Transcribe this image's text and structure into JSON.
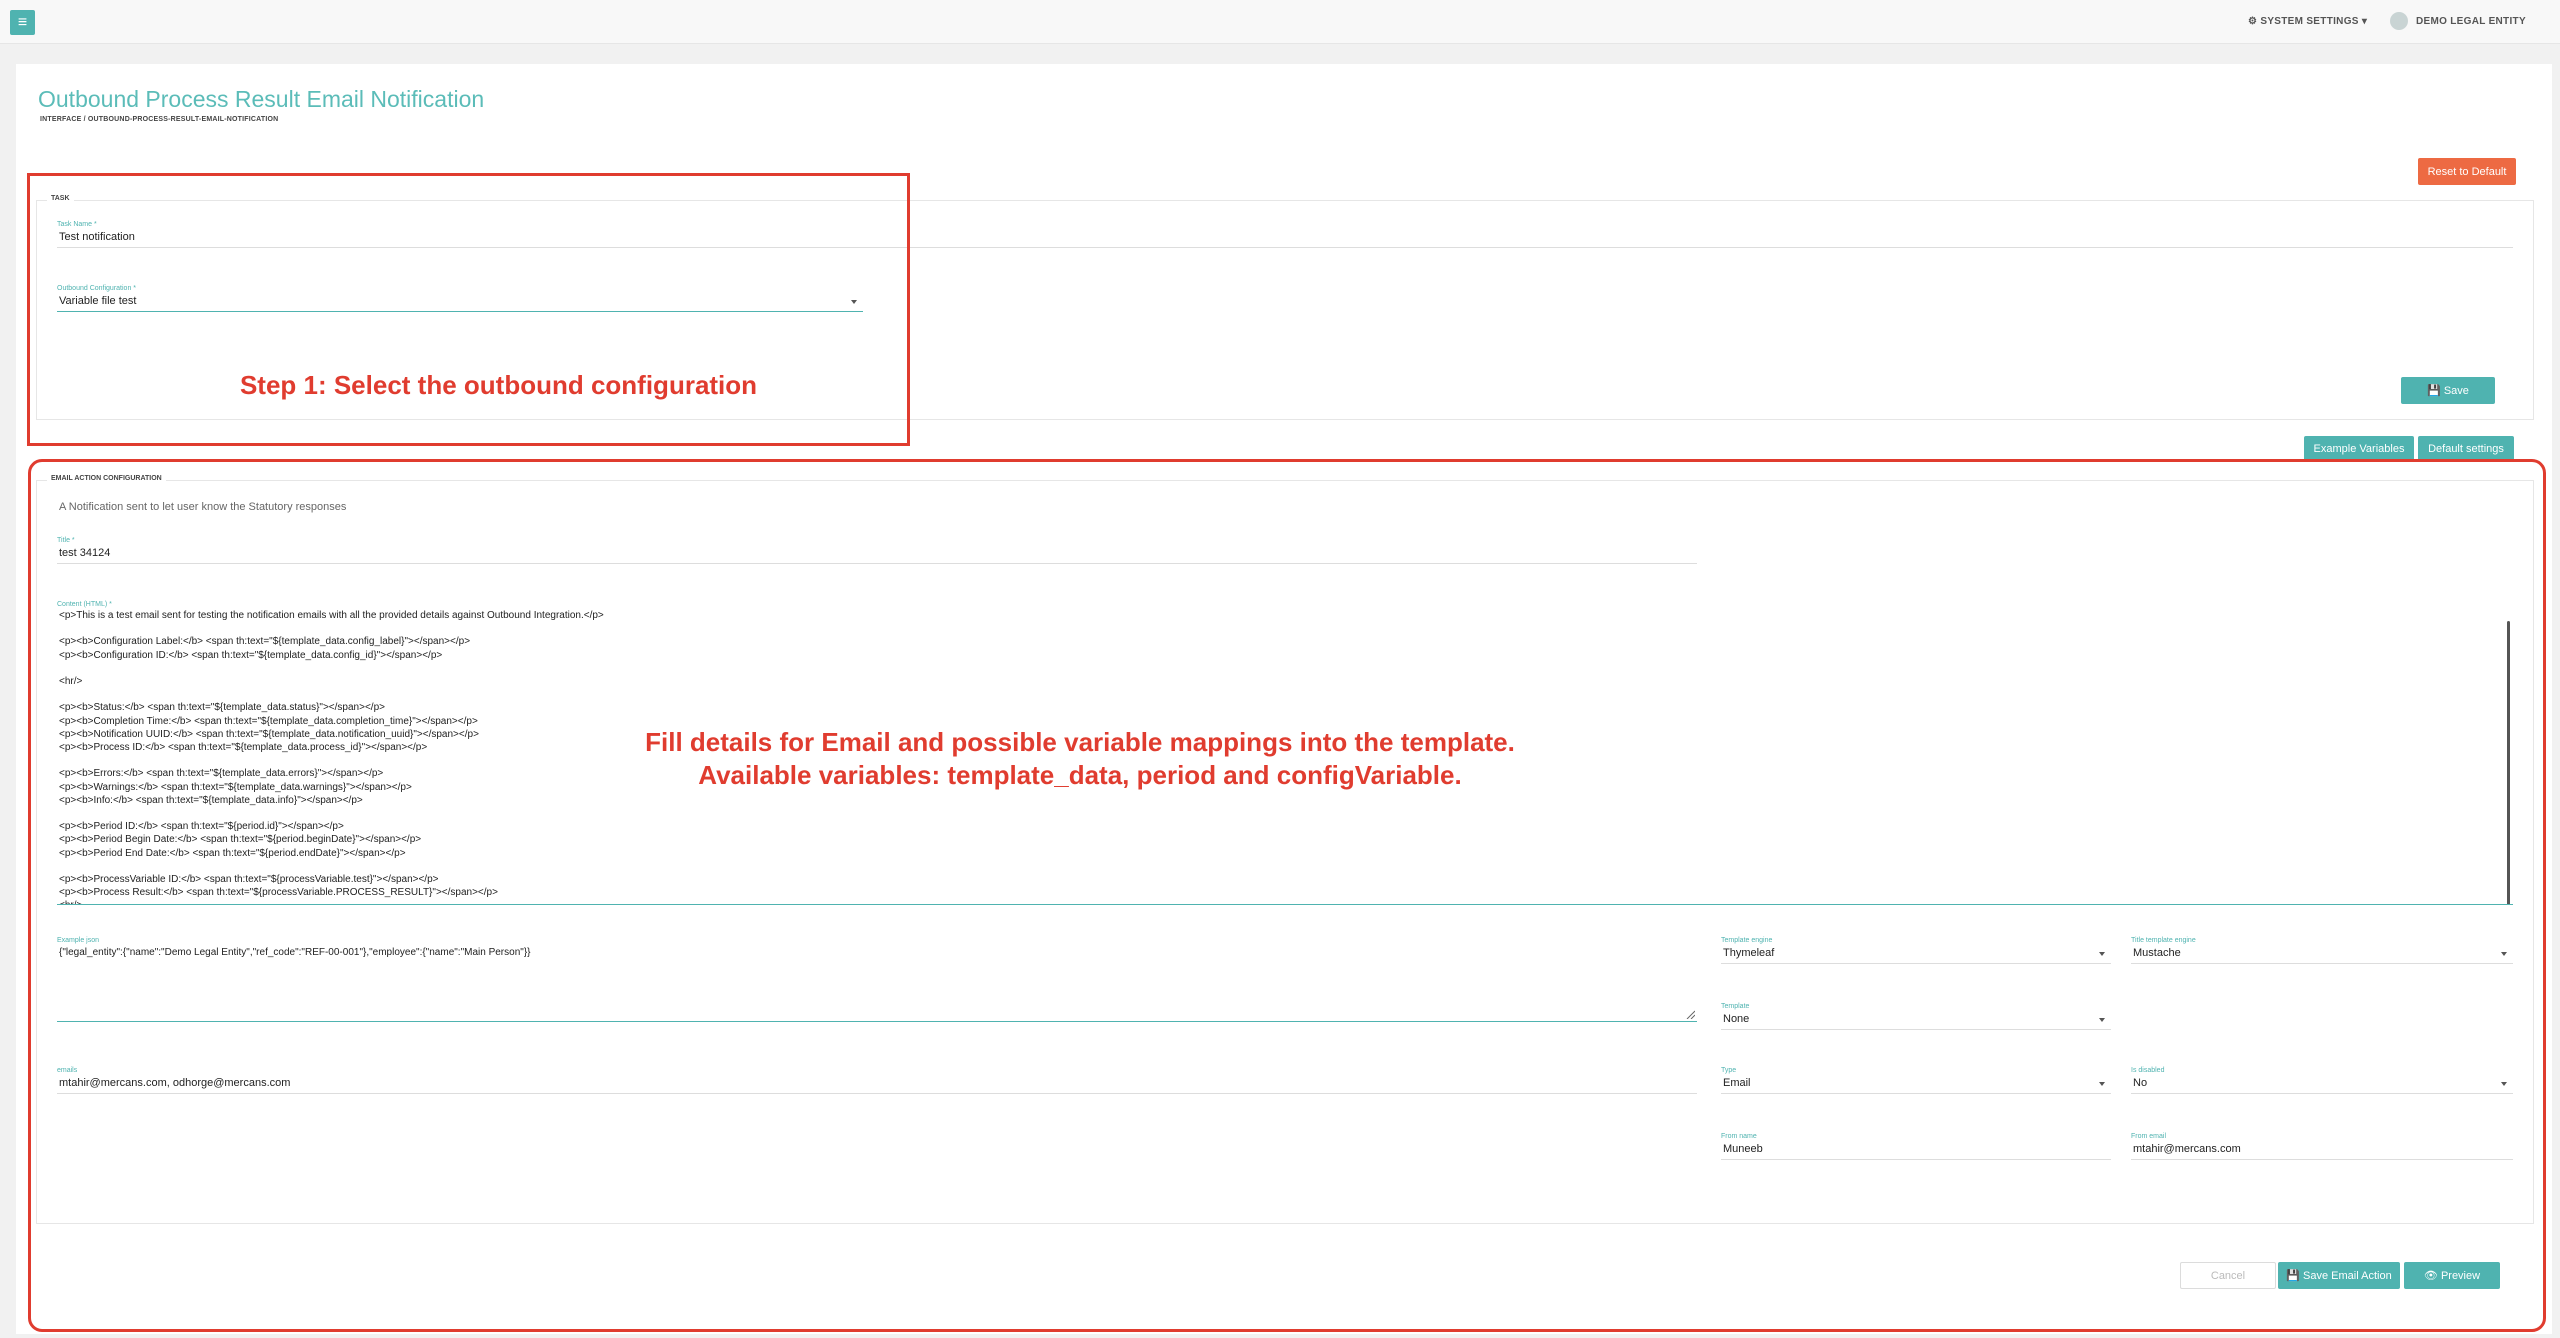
{
  "topbar": {
    "system_settings": "⚙ SYSTEM SETTINGS ▾",
    "entity_name": "DEMO LEGAL ENTITY"
  },
  "page": {
    "title": "Outbound Process Result Email Notification",
    "breadcrumb": "INTERFACE / OUTBOUND-PROCESS-RESULT-EMAIL-NOTIFICATION",
    "reset_button": "Reset to Default"
  },
  "task": {
    "legend": "TASK",
    "task_name_label": "Task Name *",
    "task_name_value": "Test notification",
    "outbound_config_label": "Outbound Configuration *",
    "outbound_config_value": "Variable file test",
    "save_button": "💾 Save"
  },
  "email_tabs": {
    "example_variables": "Example Variables",
    "default_settings": "Default settings"
  },
  "email": {
    "legend": "EMAIL ACTION CONFIGURATION",
    "description": "A Notification sent to let user know the Statutory responses",
    "title_label": "Title *",
    "title_value": "test 34124",
    "content_label": "Content (HTML) *",
    "content_lines": [
      "<p>This is a test email sent for testing the notification emails with all the provided details against Outbound Integration.</p>",
      "",
      "<p><b>Configuration Label:</b> <span th:text=\"${template_data.config_label}\"></span></p>",
      "<p><b>Configuration ID:</b> <span th:text=\"${template_data.config_id}\"></span></p>",
      "",
      "<hr/>",
      "",
      "<p><b>Status:</b> <span th:text=\"${template_data.status}\"></span></p>",
      "<p><b>Completion Time:</b> <span th:text=\"${template_data.completion_time}\"></span></p>",
      "<p><b>Notification UUID:</b> <span th:text=\"${template_data.notification_uuid}\"></span></p>",
      "<p><b>Process ID:</b> <span th:text=\"${template_data.process_id}\"></span></p>",
      "",
      "<p><b>Errors:</b> <span th:text=\"${template_data.errors}\"></span></p>",
      "<p><b>Warnings:</b> <span th:text=\"${template_data.warnings}\"></span></p>",
      "<p><b>Info:</b> <span th:text=\"${template_data.info}\"></span></p>",
      "",
      "<p><b>Period ID:</b> <span th:text=\"${period.id}\"></span></p>",
      "<p><b>Period Begin Date:</b> <span th:text=\"${period.beginDate}\"></span></p>",
      "<p><b>Period End Date:</b> <span th:text=\"${period.endDate}\"></span></p>",
      "",
      "<p><b>ProcessVariable ID:</b> <span th:text=\"${processVariable.test}\"></span></p>",
      "<p><b>Process Result:</b> <span th:text=\"${processVariable.PROCESS_RESULT}\"></span></p>",
      "<hr/>"
    ],
    "example_json_label": "Example json",
    "example_json_value": "{\"legal_entity\":{\"name\":\"Demo Legal Entity\",\"ref_code\":\"REF-00-001\"},\"employee\":{\"name\":\"Main Person\"}}",
    "template_engine_label": "Template engine",
    "template_engine_value": "Thymeleaf",
    "title_engine_label": "Title template engine",
    "title_engine_value": "Mustache",
    "template_label": "Template",
    "template_value": "None",
    "emails_label": "emails",
    "emails_value": "mtahir@mercans.com, odhorge@mercans.com",
    "type_label": "Type",
    "type_value": "Email",
    "disabled_label": "Is disabled",
    "disabled_value": "No",
    "from_name_label": "From name",
    "from_name_value": "Muneeb",
    "from_email_label": "From email",
    "from_email_value": "mtahir@mercans.com",
    "cancel_button": "Cancel",
    "save_email_button": "💾 Save Email Action",
    "preview_button": "👁 Preview"
  },
  "annotations": {
    "step1": "Step 1: Select the outbound configuration",
    "step2_line1": "Fill details for Email and possible variable mappings into the template.",
    "step2_line2": "Available variables: template_data, period and configVariable."
  },
  "colors": {
    "accent": "#4fb3b0",
    "warning": "#ed6a43",
    "annotation": "#e03c2f"
  }
}
